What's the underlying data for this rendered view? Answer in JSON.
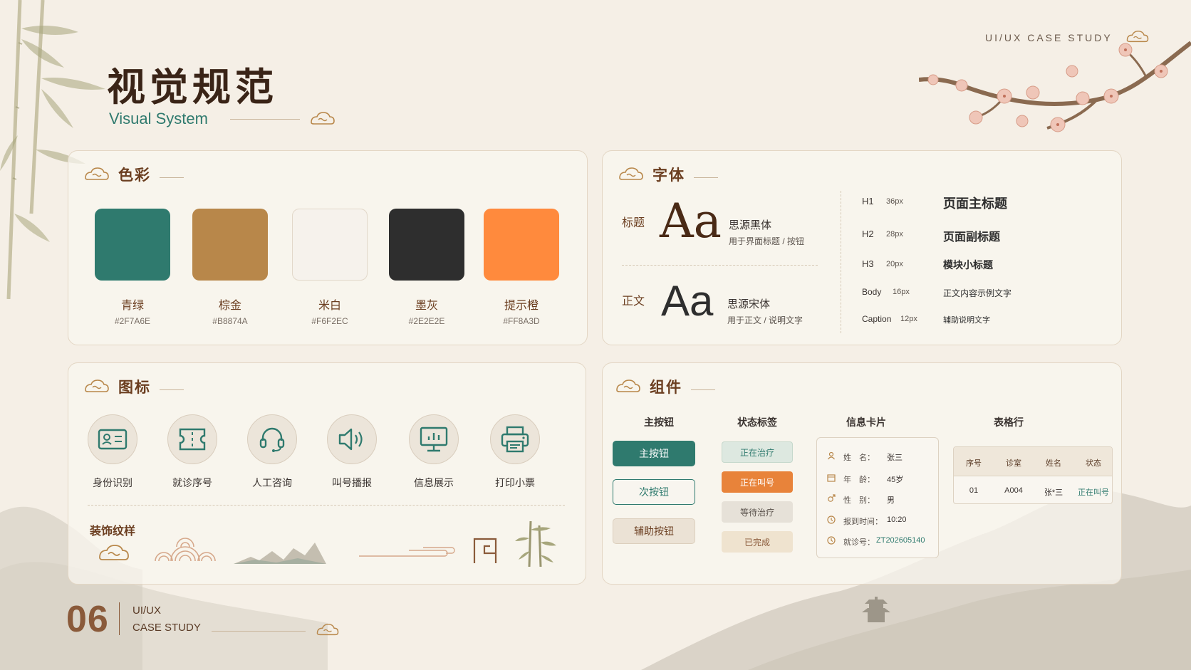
{
  "header": {
    "title_cn": "视觉规范",
    "title_en": "Visual System",
    "top_right": "UI/UX CASE STUDY"
  },
  "colors": {
    "section_title": "色彩",
    "swatches": [
      {
        "name": "青绿",
        "hex": "#2F7A6E"
      },
      {
        "name": "棕金",
        "hex": "#B8874A"
      },
      {
        "name": "米白",
        "hex": "#F6F2EC"
      },
      {
        "name": "墨灰",
        "hex": "#2E2E2E"
      },
      {
        "name": "提示橙",
        "hex": "#FF8A3D"
      }
    ]
  },
  "fonts": {
    "section_title": "字体",
    "samples": [
      {
        "label": "标题",
        "glyph": "Aa",
        "font_name": "思源黑体",
        "usage": "用于界面标题 / 按钮"
      },
      {
        "label": "正文",
        "glyph": "Aa",
        "font_name": "思源宋体",
        "usage": "用于正文 / 说明文字"
      }
    ],
    "scale": [
      {
        "level": "H1",
        "size": "36px",
        "example": "页面主标题"
      },
      {
        "level": "H2",
        "size": "28px",
        "example": "页面副标题"
      },
      {
        "level": "H3",
        "size": "20px",
        "example": "模块小标题"
      },
      {
        "level": "Body",
        "size": "16px",
        "example": "正文内容示例文字"
      },
      {
        "level": "Caption",
        "size": "12px",
        "example": "辅助说明文字"
      }
    ]
  },
  "icons": {
    "section_title": "图标",
    "items": [
      {
        "label": "身份识别",
        "icon": "id-card-icon"
      },
      {
        "label": "就诊序号",
        "icon": "ticket-icon"
      },
      {
        "label": "人工咨询",
        "icon": "headset-icon"
      },
      {
        "label": "叫号播报",
        "icon": "speaker-icon"
      },
      {
        "label": "信息展示",
        "icon": "monitor-chart-icon"
      },
      {
        "label": "打印小票",
        "icon": "printer-icon"
      }
    ],
    "pattern_label": "装饰纹样"
  },
  "components": {
    "section_title": "组件",
    "buttons_header": "主按钮",
    "buttons": {
      "primary": "主按钮",
      "secondary": "次按钮",
      "auxiliary": "辅助按钮"
    },
    "tags_header": "状态标签",
    "tags": [
      {
        "label": "正在治疗",
        "style": "green"
      },
      {
        "label": "正在叫号",
        "style": "orange"
      },
      {
        "label": "等待治疗",
        "style": "gray"
      },
      {
        "label": "已完成",
        "style": "beige"
      }
    ],
    "card_header": "信息卡片",
    "card_rows": [
      {
        "icon": "person-icon",
        "label": "姓　名：",
        "value": "张三"
      },
      {
        "icon": "calendar-icon",
        "label": "年　龄：",
        "value": "45岁"
      },
      {
        "icon": "gender-icon",
        "label": "性　别：",
        "value": "男"
      },
      {
        "icon": "clock-icon",
        "label": "报到时间：",
        "value": "10:20"
      },
      {
        "icon": "clock-icon",
        "label": "就诊号：",
        "value": "ZT202605140"
      }
    ],
    "table_header": "表格行",
    "table": {
      "columns": [
        "序号",
        "诊室",
        "姓名",
        "状态"
      ],
      "row": [
        "01",
        "A004",
        "张*三",
        "正在叫号"
      ]
    }
  },
  "footer": {
    "page_number": "06",
    "line1": "UI/UX",
    "line2": "CASE STUDY"
  },
  "palette": {
    "accent_green": "#2F7A6E",
    "accent_brown": "#6B3E20",
    "accent_orange": "#E8833A"
  }
}
